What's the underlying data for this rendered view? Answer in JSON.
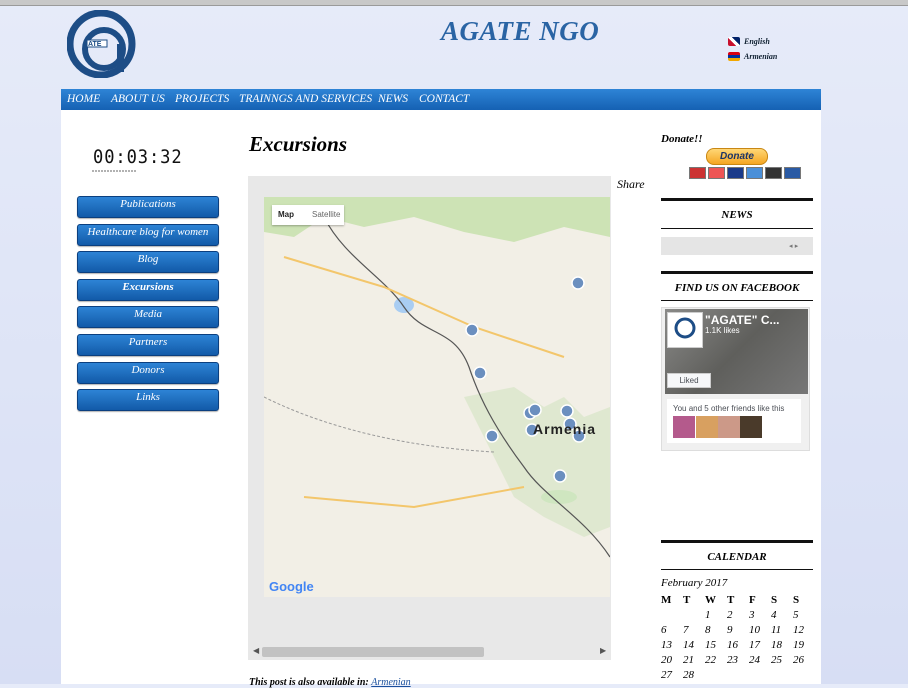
{
  "site": {
    "title": "AGATE NGO",
    "logo_text": "ATE"
  },
  "languages": [
    {
      "label": "English"
    },
    {
      "label": "Armenian"
    }
  ],
  "nav": [
    "HOME",
    "ABOUT US",
    "PROJECTS",
    "TRAINNGS AND SERVICES",
    "NEWS",
    "CONTACT"
  ],
  "counter": {
    "value": "00:03:32"
  },
  "sidebar": [
    {
      "label": "Publications"
    },
    {
      "label": "Healthcare blog for women"
    },
    {
      "label": "Blog"
    },
    {
      "label": "Excursions",
      "active": true
    },
    {
      "label": "Media"
    },
    {
      "label": "Partners"
    },
    {
      "label": "Donors"
    },
    {
      "label": "Links"
    }
  ],
  "main": {
    "heading": "Excursions",
    "share": "Share",
    "map": {
      "tab_map": "Map",
      "tab_satellite": "Satellite",
      "country_label": "Armenia",
      "attribution": "Google"
    },
    "post_note": "This post is also available in:",
    "post_note_link": "Armenian"
  },
  "right": {
    "donate_label": "Donate!!",
    "donate_button": "Donate",
    "news_title": "NEWS",
    "facebook_title": "FIND US ON FACEBOOK",
    "facebook": {
      "page_name": "\"AGATE\" C...",
      "likes": "1.1K likes",
      "liked_button": "Liked",
      "friends_text": "You and 5 other friends like this"
    },
    "calendar_title": "CALENDAR",
    "calendar": {
      "caption": "February 2017",
      "weekdays": [
        "M",
        "T",
        "W",
        "T",
        "F",
        "S",
        "S"
      ],
      "weeks": [
        [
          "",
          "",
          "1",
          "2",
          "3",
          "4",
          "5"
        ],
        [
          "6",
          "7",
          "8",
          "9",
          "10",
          "11",
          "12"
        ],
        [
          "13",
          "14",
          "15",
          "16",
          "17",
          "18",
          "19"
        ],
        [
          "20",
          "21",
          "22",
          "23",
          "24",
          "25",
          "26"
        ],
        [
          "27",
          "28",
          "",
          "",
          "",
          "",
          ""
        ]
      ]
    }
  },
  "colors": {
    "nav_blue": "#1a6bc1",
    "title_blue": "#2a64a4",
    "page_bg": "#dfe4f7"
  },
  "icons": [
    "uk-flag-icon",
    "armenia-flag-icon",
    "map-marker-icon",
    "card-icons"
  ]
}
